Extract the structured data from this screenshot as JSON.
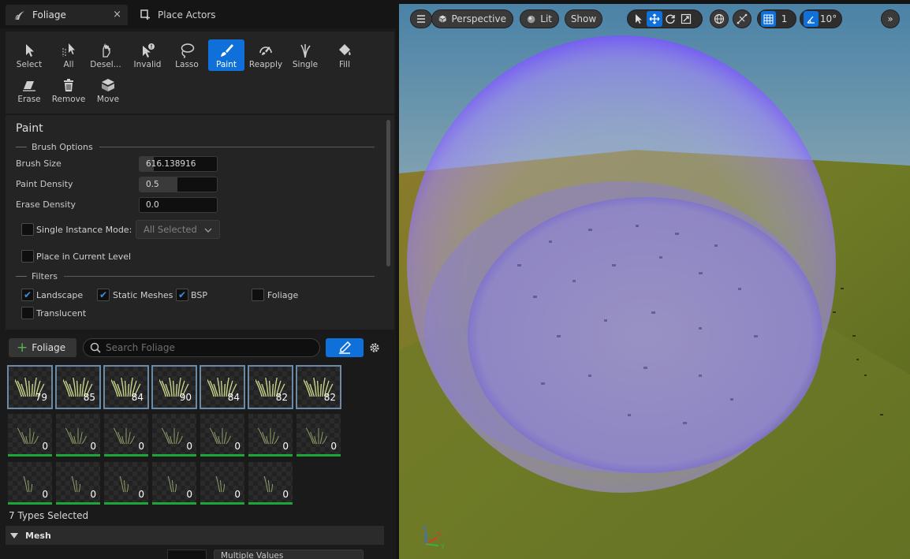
{
  "tabs": {
    "foliage": {
      "label": "Foliage",
      "close": "×"
    },
    "place_actors": {
      "label": "Place Actors"
    }
  },
  "tools": [
    {
      "label": "Select",
      "icon": "cursor-icon"
    },
    {
      "label": "All",
      "icon": "select-all-icon"
    },
    {
      "label": "Desel...",
      "icon": "deselect-icon"
    },
    {
      "label": "Invalid",
      "icon": "invalid-icon"
    },
    {
      "label": "Lasso",
      "icon": "lasso-icon"
    },
    {
      "label": "Paint",
      "icon": "paintbrush-icon",
      "active": true
    },
    {
      "label": "Reapply",
      "icon": "reapply-icon"
    },
    {
      "label": "Single",
      "icon": "single-icon"
    },
    {
      "label": "Fill",
      "icon": "fill-bucket-icon"
    },
    {
      "label": "Erase",
      "icon": "eraser-icon"
    },
    {
      "label": "Remove",
      "icon": "trash-icon"
    },
    {
      "label": "Move",
      "icon": "move-icon"
    }
  ],
  "details": {
    "title": "Paint",
    "brush_options": "Brush Options",
    "brush_size_label": "Brush Size",
    "brush_size_value": "616.138916",
    "paint_density_label": "Paint Density",
    "paint_density_value": "0.5",
    "erase_density_label": "Erase Density",
    "erase_density_value": "0.0",
    "single_instance_label": "Single Instance Mode:",
    "single_instance_value": "All Selected",
    "place_current_label": "Place in Current Level",
    "filters": "Filters",
    "filter_landscape": "Landscape",
    "filter_static": "Static Meshes",
    "filter_bsp": "BSP",
    "filter_foliage": "Foliage",
    "filter_translucent": "Translucent"
  },
  "assets": {
    "add_label": "Foliage",
    "search_placeholder": "Search Foliage",
    "counts": [
      "79",
      "85",
      "84",
      "90",
      "84",
      "82",
      "82",
      "0",
      "0",
      "0",
      "0",
      "0",
      "0",
      "0",
      "0",
      "0",
      "0",
      "0",
      "0",
      "0"
    ],
    "status": "7 Types Selected",
    "mesh_header": "Mesh",
    "mesh_value": "Multiple Values"
  },
  "viewport": {
    "perspective": "Perspective",
    "lit": "Lit",
    "show": "Show",
    "grid_value": "1",
    "angle_value": "10°"
  },
  "colors": {
    "accent": "#0e70d8",
    "active_bar": "#1fa43a"
  }
}
